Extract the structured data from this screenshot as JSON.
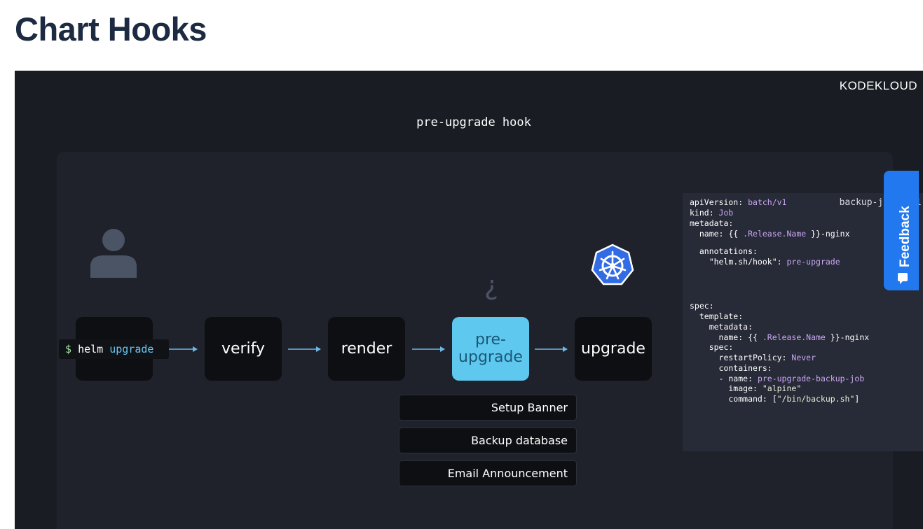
{
  "page": {
    "title": "Chart Hooks"
  },
  "slide": {
    "logo": "KODEKLOUD",
    "title": "pre-upgrade hook",
    "command": {
      "prompt": "$",
      "tool": "helm",
      "subcommand": "upgrade"
    },
    "steps": [
      {
        "label": "verify"
      },
      {
        "label": "render"
      },
      {
        "label_line1": "pre-",
        "label_line2": "upgrade"
      },
      {
        "label": "upgrade"
      }
    ],
    "hook_tasks": [
      "Setup Banner",
      "Backup database",
      "Email Announcement"
    ],
    "colors": {
      "background": "#1a1c23",
      "accent": "#5fc8ef",
      "arrow": "#6fb7e6",
      "kubernetes": "#326ce5"
    }
  },
  "code": {
    "filename": "backup-job.yaml",
    "lines": [
      {
        "k": "apiVersion: ",
        "v": "batch/v1"
      },
      {
        "k": "kind: ",
        "v": "Job"
      },
      {
        "k": "metadata:",
        "v": ""
      },
      {
        "k": "  name: {{ ",
        "v": ".Release.Name",
        "r": " }}-nginx"
      },
      {
        "k": "  annotations:",
        "v": ""
      },
      {
        "k": "    \"helm.sh/hook\": ",
        "v": "pre-upgrade"
      },
      {
        "k": "spec:",
        "v": ""
      },
      {
        "k": "  template:",
        "v": ""
      },
      {
        "k": "    metadata:",
        "v": ""
      },
      {
        "k": "      name: {{ ",
        "v": ".Release.Name",
        "r": " }}-nginx"
      },
      {
        "k": "    spec:",
        "v": ""
      },
      {
        "k": "      restartPolicy: ",
        "v": "Never"
      },
      {
        "k": "      containers:",
        "v": ""
      },
      {
        "k": "      - name: ",
        "v": "pre-upgrade-backup-job"
      },
      {
        "k": "        image: ",
        "s": "\"alpine\""
      },
      {
        "k": "        command: [",
        "s": "\"/bin/backup.sh\"",
        "r": "]"
      }
    ]
  },
  "feedback": {
    "label": "Feedback"
  },
  "icons": {
    "user": "user-icon",
    "kubernetes": "kubernetes-icon",
    "hook": "hook-icon",
    "feedback": "chat-bubble-icon"
  }
}
